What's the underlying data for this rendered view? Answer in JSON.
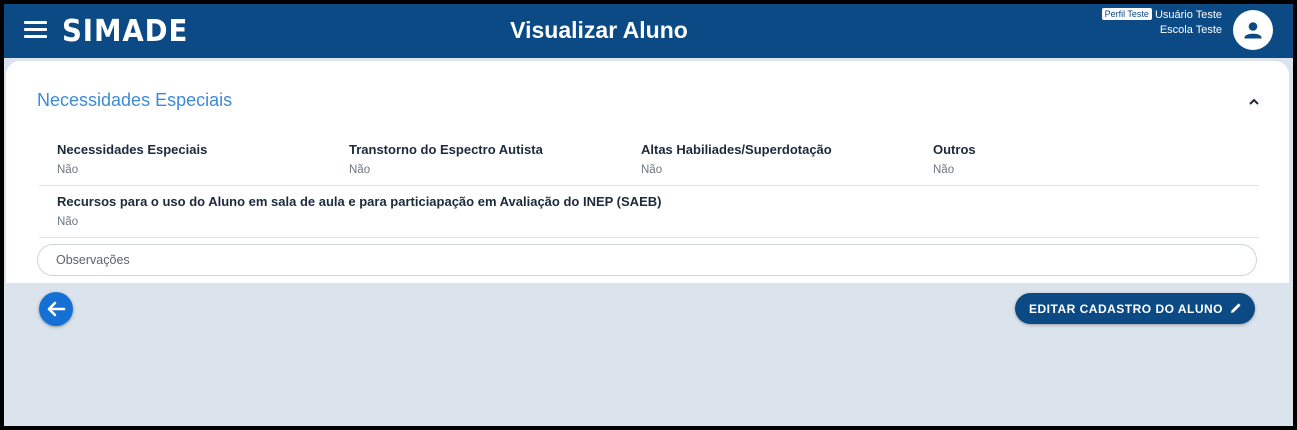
{
  "header": {
    "logo": "SIMADE",
    "title": "Visualizar Aluno",
    "profile_badge": "Perfil Teste",
    "user_name": "Usuário Teste",
    "school": "Escola Teste",
    "menu_icon": "hamburger-menu-icon",
    "avatar_icon": "user-icon"
  },
  "section": {
    "title": "Necessidades Especiais",
    "collapse_icon": "chevron-up-icon",
    "fields": [
      {
        "label": "Necessidades Especiais",
        "value": "Não"
      },
      {
        "label": "Transtorno do Espectro Autista",
        "value": "Não"
      },
      {
        "label": "Altas Habiliades/Superdotação",
        "value": "Não"
      },
      {
        "label": "Outros",
        "value": "Não"
      },
      {
        "label": "Recursos para o uso do Aluno em sala de aula e para particiapação em Avaliação do INEP (SAEB)",
        "value": "Não"
      }
    ],
    "observacoes": {
      "placeholder": "Observações",
      "value": ""
    }
  },
  "actions": {
    "back_icon": "arrow-left-icon",
    "edit_label": "EDITAR CADASTRO DO ALUNO",
    "edit_icon": "pencil-icon"
  },
  "colors": {
    "primary": "#0b4a85",
    "accent": "#3d8ad8",
    "back_button": "#1570d6",
    "background": "#dbe3ec"
  }
}
